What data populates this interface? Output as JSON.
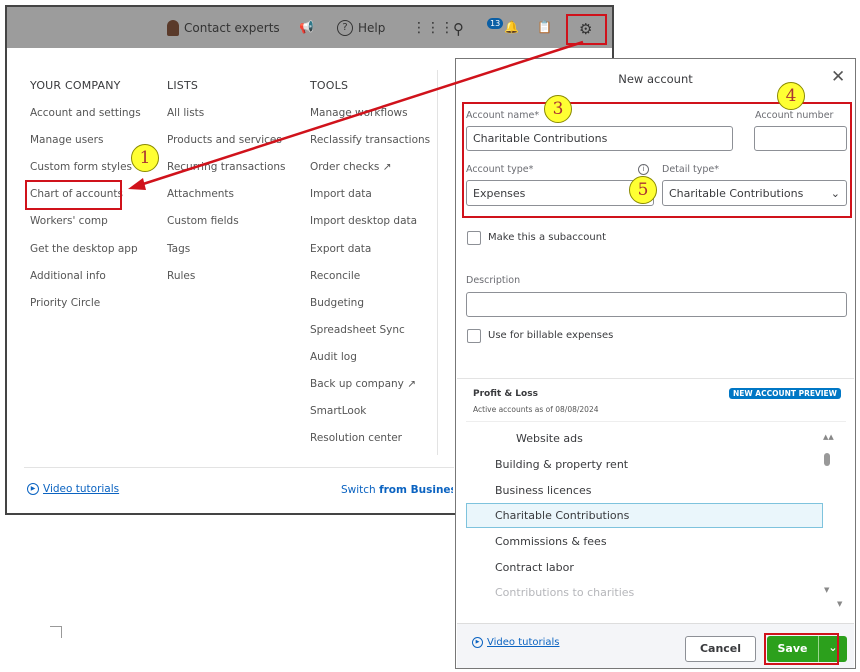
{
  "topbar": {
    "contact_experts": "Contact experts",
    "help": "Help",
    "notification_count": "13"
  },
  "menu": {
    "your_company": {
      "heading": "YOUR COMPANY",
      "items": [
        "Account and settings",
        "Manage users",
        "Custom form styles",
        "Chart of accounts",
        "Workers' comp",
        "Get the desktop app",
        "Additional info",
        "Priority Circle"
      ]
    },
    "lists": {
      "heading": "LISTS",
      "items": [
        "All lists",
        "Products and services",
        "Recurring transactions",
        "Attachments",
        "Custom fields",
        "Tags",
        "Rules"
      ]
    },
    "tools": {
      "heading": "TOOLS",
      "items": [
        "Manage workflows",
        "Reclassify transactions",
        "Order checks",
        "Import data",
        "Import desktop data",
        "Export data",
        "Reconcile",
        "Budgeting",
        "Spreadsheet Sync",
        "Audit log",
        "Back up company",
        "SmartLook",
        "Resolution center"
      ]
    },
    "video_tutorials": "Video tutorials",
    "switch_text": "Switch",
    "switch_bold": "from Business v"
  },
  "modal": {
    "title": "New account",
    "account_name_label": "Account name*",
    "account_name_value": "Charitable Contributions",
    "account_number_label": "Account number",
    "account_number_value": "",
    "account_type_label": "Account type*",
    "account_type_value": "Expenses",
    "detail_type_label": "Detail type*",
    "detail_type_value": "Charitable Contributions",
    "subaccount_label": "Make this a subaccount",
    "description_label": "Description",
    "description_value": "",
    "billable_label": "Use for billable expenses",
    "preview": {
      "title": "Profit & Loss",
      "subtitle": "Active accounts as of 08/08/2024",
      "badge": "NEW ACCOUNT PREVIEW",
      "rows": [
        "Website ads",
        "Building & property rent",
        "Business licences",
        "Charitable Contributions",
        "Commissions & fees",
        "Contract labor",
        "Contributions to charities"
      ],
      "selected": "Charitable Contributions"
    },
    "video_tutorials": "Video tutorials",
    "cancel": "Cancel",
    "save": "Save"
  },
  "annotations": [
    "1",
    "3",
    "4",
    "5"
  ],
  "colors": {
    "annotation": "#d0121b",
    "save_green": "#2ca01c",
    "badge_blue": "#0077c5",
    "link": "#0b63c1",
    "highlight": "#eaf6fb"
  }
}
